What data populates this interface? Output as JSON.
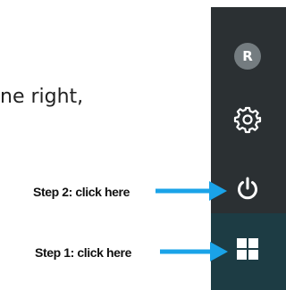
{
  "body_text": "ne right,",
  "start_menu": {
    "avatar_initial": "R",
    "icons": {
      "user": "user-avatar-icon",
      "settings": "gear-icon",
      "power": "power-icon",
      "start": "windows-logo-icon"
    }
  },
  "steps": [
    {
      "label": "Step 2: click here"
    },
    {
      "label": "Step 1: click here"
    }
  ],
  "colors": {
    "rail": "#2b3033",
    "start_tile": "#1d3c44",
    "arrow": "#1aa3e8",
    "icon": "#ffffff",
    "avatar_bg": "#747c80"
  }
}
